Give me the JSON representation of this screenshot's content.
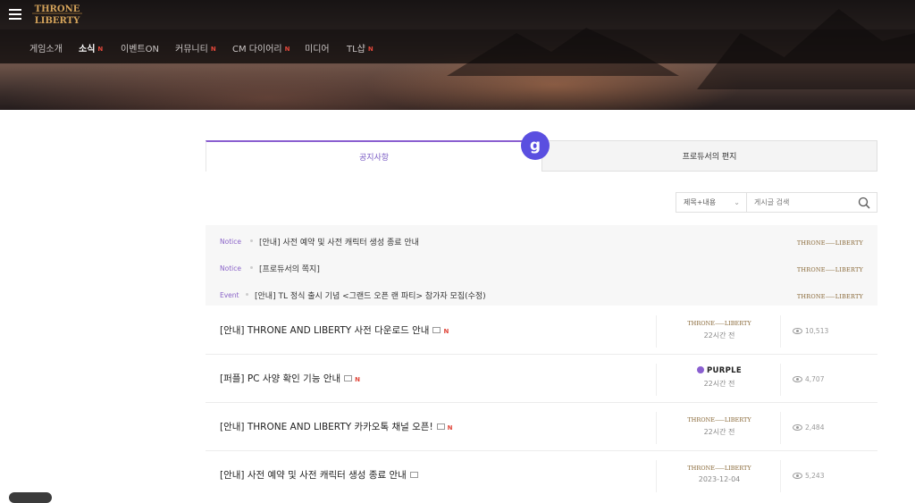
{
  "header": {
    "logo_text": "THRONE LIBERTY",
    "nav": [
      {
        "label": "게임소개",
        "new": ""
      },
      {
        "label": "소식",
        "new": "N"
      },
      {
        "label": "이벤트ON",
        "new": ""
      },
      {
        "label": "커뮤니티",
        "new": "N"
      },
      {
        "label": "CM 다이어리",
        "new": "N"
      },
      {
        "label": "미디어",
        "new": ""
      },
      {
        "label": "TL샵",
        "new": "N"
      }
    ]
  },
  "tabs": {
    "notice_label": "공지사항",
    "letter_label": "프로듀서의 편지"
  },
  "search": {
    "select_value": "제목+내용",
    "placeholder": "게시글 검색"
  },
  "pinned": [
    {
      "category": "Notice",
      "title": "[안내] 사전 예약 및 사전 캐릭터 생성 종료 안내",
      "brand": "THRONE⸺LIBERTY"
    },
    {
      "category": "Notice",
      "title": "[프로듀서의 쪽지]",
      "brand": "THRONE⸺LIBERTY"
    },
    {
      "category": "Event",
      "title": "[안내] TL 정식 출시 기념 <그랜드 오픈 랜 파티> 참가자 모집(수정)",
      "brand": "THRONE⸺LIBERTY"
    }
  ],
  "posts": [
    {
      "title": "[안내] THRONE AND LIBERTY 사전 다운로드 안내",
      "new": "N",
      "author": "THRONE⸺LIBERTY",
      "time": "22시간 전",
      "views": "10,513"
    },
    {
      "title": "[퍼플] PC 사양 확인 기능 안내",
      "new": "N",
      "author": "PURPLE",
      "time": "22시간 전",
      "views": "4,707"
    },
    {
      "title": "[안내] THRONE AND LIBERTY 카카오톡 채널 오픈!",
      "new": "N",
      "author": "THRONE⸺LIBERTY",
      "time": "22시간 전",
      "views": "2,484"
    },
    {
      "title": "[안내] 사전 예약 및 사전 캐릭터 생성 종료 안내",
      "new": "",
      "author": "THRONE⸺LIBERTY",
      "time": "2023-12-04",
      "views": "5,243"
    }
  ],
  "colors": {
    "accent": "#8a5fd0",
    "new_badge": "#e0463a",
    "brand_gold": "#8a6a3a"
  }
}
